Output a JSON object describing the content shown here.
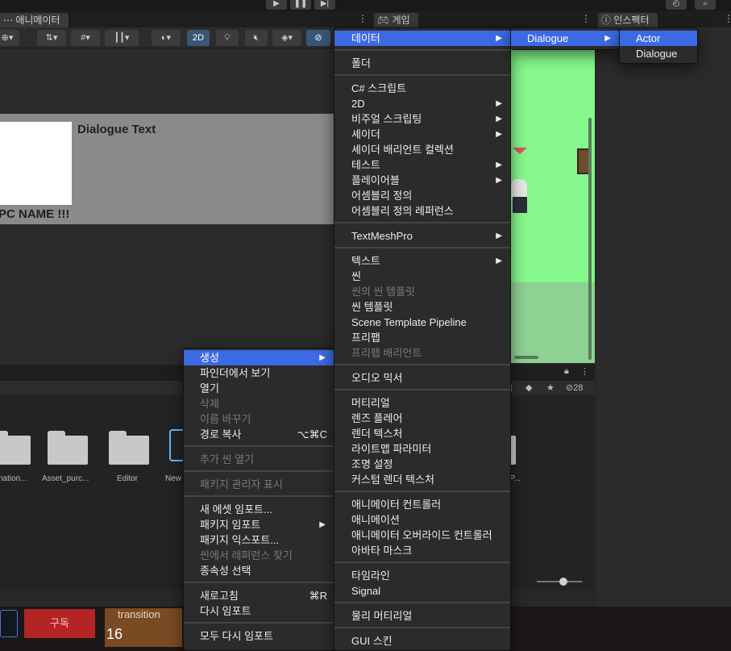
{
  "top_toolbar": {
    "play": "▶",
    "pause": "❚❚",
    "step": "▶|"
  },
  "animator": {
    "tab": "애니메이터",
    "toggle_2d": "2D"
  },
  "game": {
    "tab": "게임"
  },
  "inspector": {
    "tab": "인스펙터"
  },
  "dialogue_preview": {
    "title": "Dialogue Text",
    "npc_name": "PC NAME !!!"
  },
  "project": {
    "hidden_count": "28",
    "folders": [
      "nation...",
      "Asset_purc...",
      "Editor",
      "New",
      "...P..."
    ]
  },
  "taskbar": {
    "subscribe": "구독",
    "transition_label": "transition",
    "transition_number": "16"
  },
  "asset_menu": {
    "items": [
      {
        "label": "생성",
        "submenu": true,
        "selected": true
      },
      {
        "label": "파인더에서 보기"
      },
      {
        "label": "열기"
      },
      {
        "label": "삭제",
        "disabled": true
      },
      {
        "label": "이름 바꾸기",
        "disabled": true
      },
      {
        "label": "경로 복사",
        "shortcut": "⌥⌘C"
      },
      {
        "separator": true
      },
      {
        "label": "추가 씬 열기",
        "disabled": true
      },
      {
        "separator": true
      },
      {
        "label": "패키지 관리자 표시",
        "disabled": true
      },
      {
        "separator": true
      },
      {
        "label": "새 에셋 임포트..."
      },
      {
        "label": "패키지 임포트",
        "submenu": true
      },
      {
        "label": "패키지 익스포트..."
      },
      {
        "label": "씬에서 레퍼런스 찾기",
        "disabled": true
      },
      {
        "label": "종속성 선택"
      },
      {
        "separator": true
      },
      {
        "label": "새로고침",
        "shortcut": "⌘R"
      },
      {
        "label": "다시 임포트"
      },
      {
        "separator": true
      },
      {
        "label": "모두 다시 임포트"
      }
    ]
  },
  "create_menu": {
    "items": [
      {
        "label": "데이터",
        "submenu": true,
        "selected": true
      },
      {
        "separator": true
      },
      {
        "label": "폴더"
      },
      {
        "separator": true
      },
      {
        "label": "C# 스크립트"
      },
      {
        "label": "2D",
        "submenu": true
      },
      {
        "label": "비주얼 스크립팅",
        "submenu": true
      },
      {
        "label": "셰이더",
        "submenu": true
      },
      {
        "label": "셰이더 배리언트 컬렉션"
      },
      {
        "label": "테스트",
        "submenu": true
      },
      {
        "label": "플레이어블",
        "submenu": true
      },
      {
        "label": "어셈블리 정의"
      },
      {
        "label": "어셈블리 정의 레퍼런스"
      },
      {
        "separator": true
      },
      {
        "label": "TextMeshPro",
        "submenu": true
      },
      {
        "separator": true
      },
      {
        "label": "텍스트",
        "submenu": true
      },
      {
        "label": "씬"
      },
      {
        "label": "씬의 씬 템플릿",
        "disabled": true
      },
      {
        "label": "씬 템플릿"
      },
      {
        "label": "Scene Template Pipeline"
      },
      {
        "label": "프리팹"
      },
      {
        "label": "프리팹 배리언트",
        "disabled": true
      },
      {
        "separator": true
      },
      {
        "label": "오디오 믹서"
      },
      {
        "separator": true
      },
      {
        "label": "머티리얼"
      },
      {
        "label": "렌즈 플레어"
      },
      {
        "label": "렌더 텍스처"
      },
      {
        "label": "라이트맵 파라미터"
      },
      {
        "label": "조명 설정"
      },
      {
        "label": "커스텀 렌더 텍스처"
      },
      {
        "separator": true
      },
      {
        "label": "애니메이터 컨트롤러"
      },
      {
        "label": "애니메이션"
      },
      {
        "label": "애니메이터 오버라이드 컨트롤러"
      },
      {
        "label": "아바타 마스크"
      },
      {
        "separator": true
      },
      {
        "label": "타임라인"
      },
      {
        "label": "Signal"
      },
      {
        "separator": true
      },
      {
        "label": "물리 머티리얼"
      },
      {
        "separator": true
      },
      {
        "label": "GUI 스킨"
      }
    ]
  },
  "data_menu": {
    "items": [
      {
        "label": "Dialogue",
        "submenu": true,
        "selected": true
      }
    ]
  },
  "dialogue_menu": {
    "items": [
      {
        "label": "Actor",
        "selected": true
      },
      {
        "label": "Dialogue"
      }
    ]
  },
  "colors": {
    "menu_bg": "#2b2b2b",
    "menu_highlight": "#3b6ae4",
    "game_background": "#85f78b",
    "disabled_text": "#7a7a7a"
  }
}
